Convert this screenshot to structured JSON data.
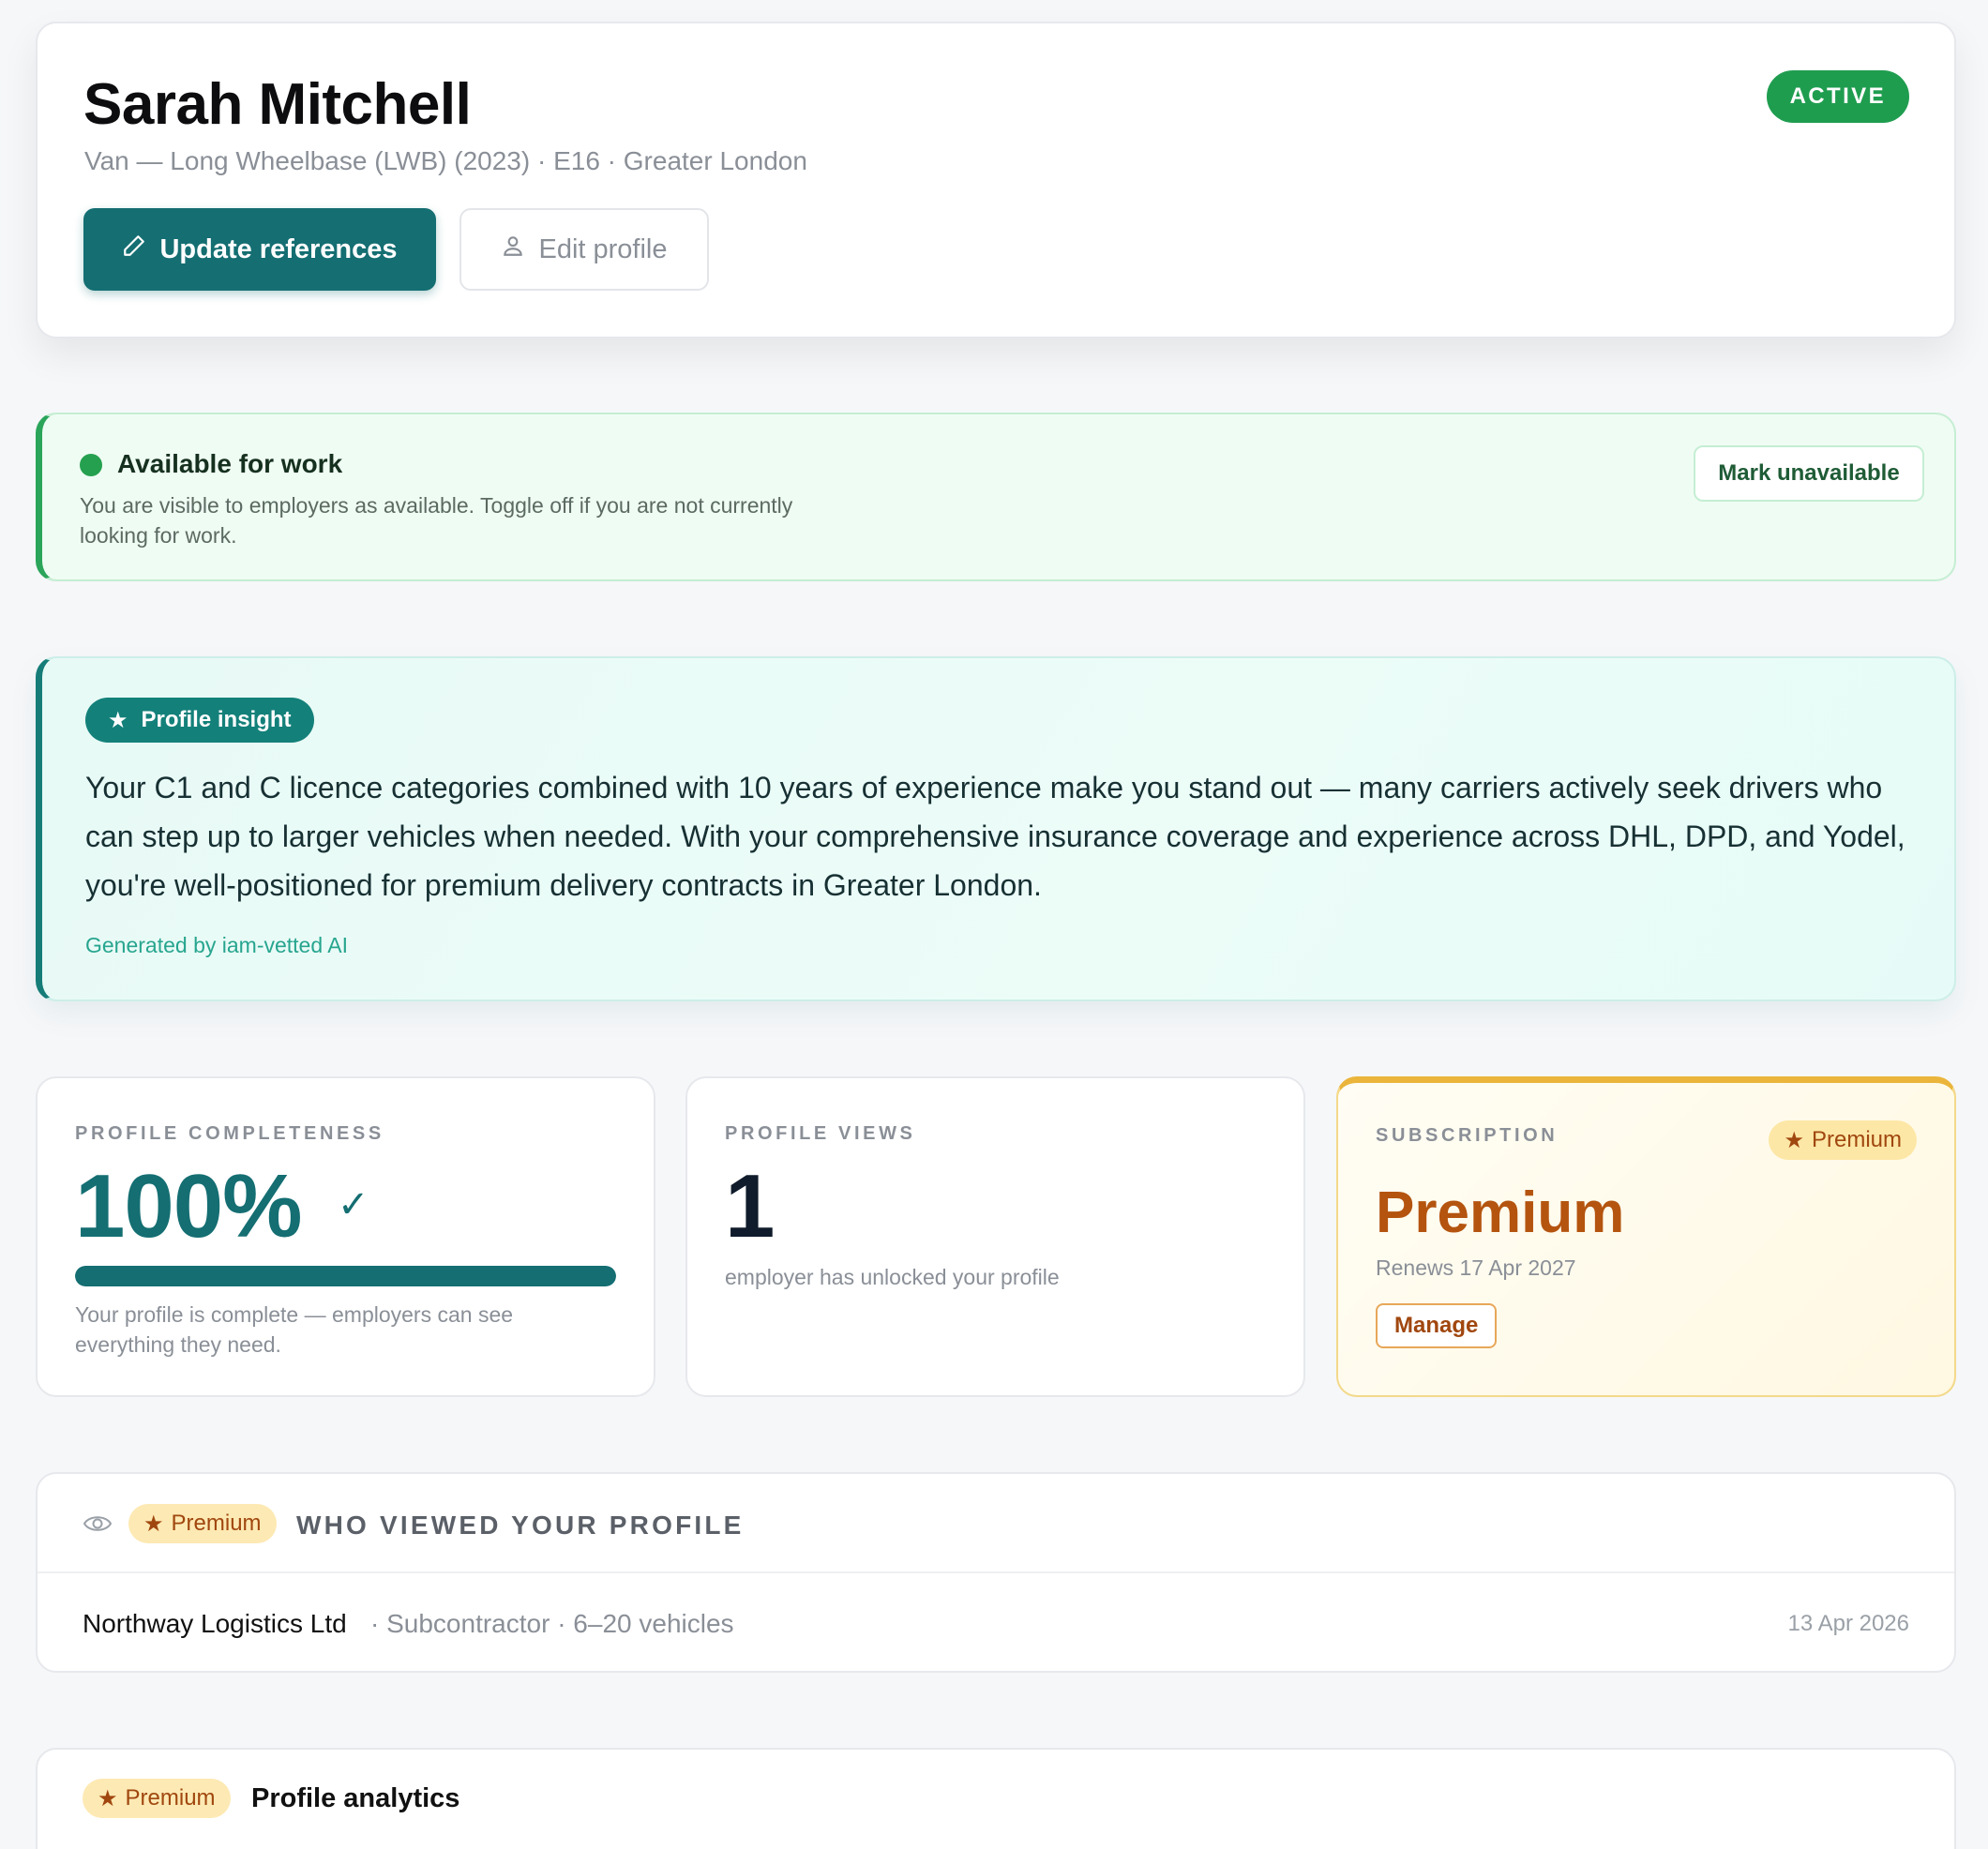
{
  "profile": {
    "name": "Sarah Mitchell",
    "subtitle": "Van — Long Wheelbase (LWB) (2023) · E16 · Greater London",
    "status": "ACTIVE",
    "actions": {
      "update_references": "Update references",
      "edit_profile": "Edit profile"
    }
  },
  "availability": {
    "title": "Available for work",
    "description": "You are visible to employers as available. Toggle off if you are not currently looking for work.",
    "toggle_label": "Mark unavailable"
  },
  "insight": {
    "badge": "Profile insight",
    "text": "Your C1 and C licence categories combined with 10 years of experience make you stand out — many carriers actively seek drivers who can step up to larger vehicles when needed. With your comprehensive insurance coverage and experience across DHL, DPD, and Yodel, you're well-positioned for premium delivery contracts in Greater London.",
    "footnote": "Generated by iam-vetted AI"
  },
  "stats": {
    "completeness": {
      "label": "PROFILE COMPLETENESS",
      "value": "100%",
      "progress_fraction": 1.0,
      "note": "Your profile is complete — employers can see everything they need."
    },
    "views": {
      "label": "PROFILE VIEWS",
      "value": "1",
      "note": "employer has unlocked your profile"
    },
    "subscription": {
      "label": "SUBSCRIPTION",
      "tier_pill": "Premium",
      "plan": "Premium",
      "renewal": "Renews 17 Apr 2027",
      "manage_label": "Manage"
    }
  },
  "who_viewed": {
    "pill": "Premium",
    "title": "WHO VIEWED YOUR PROFILE",
    "rows": [
      {
        "name": "Northway Logistics Ltd",
        "meta": " · Subcontractor · 6–20 vehicles",
        "date": "13 Apr 2026"
      }
    ]
  },
  "analytics": {
    "pill": "Premium",
    "title": "Profile analytics"
  },
  "icons": {
    "edit": "pencil-icon",
    "user": "user-icon",
    "star": "star-icon",
    "check": "check-icon",
    "eye": "eye-icon"
  },
  "colors": {
    "primary_teal": "#146e72",
    "status_green": "#1f9d4f",
    "premium_orange": "#b4540f",
    "premium_gold": "#eab53a"
  }
}
